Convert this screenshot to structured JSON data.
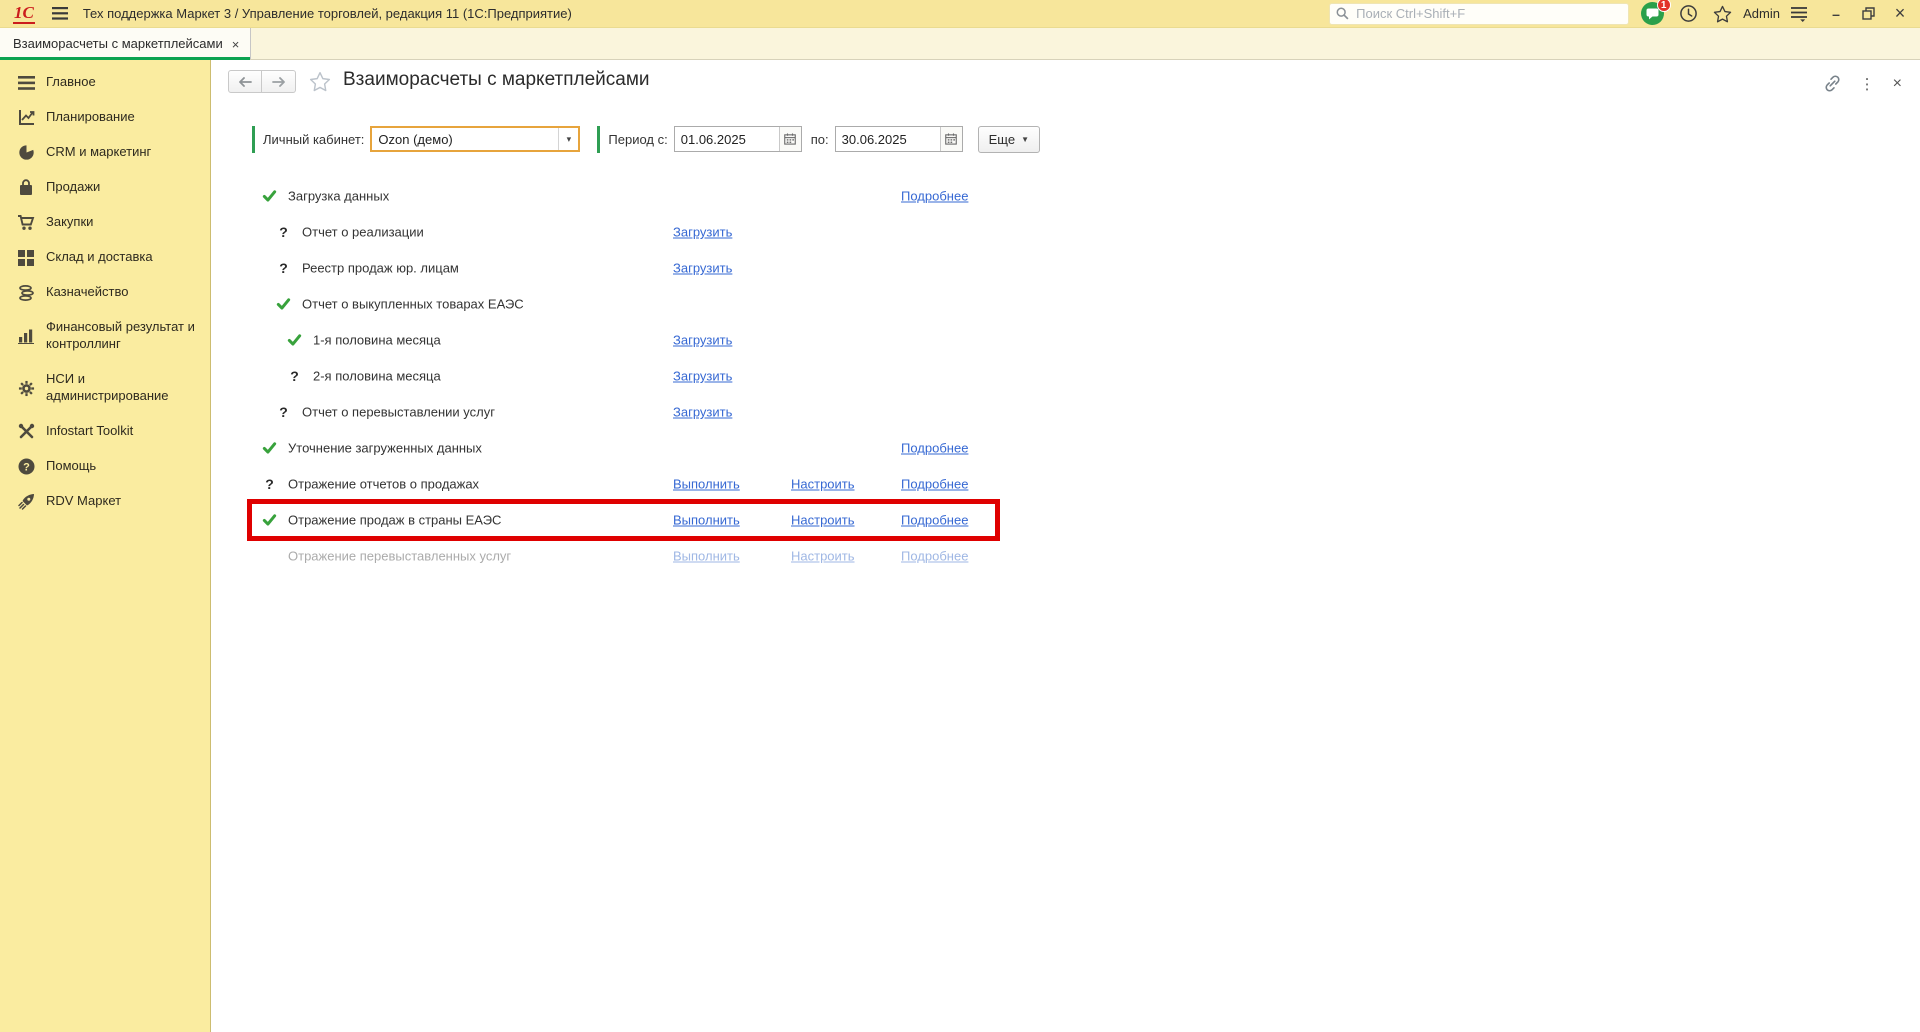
{
  "colors": {
    "topbar_bg": "#F7E69B",
    "sidebar_bg": "#FAECA0",
    "tab_underline_green": "#0BA351",
    "filter_separator_green": "#2F9E53",
    "status_done_green": "#38A23C",
    "link_blue": "#3668D3",
    "link_disabled_blue": "#9FB7E4",
    "text_disabled_gray": "#ABABAB",
    "highlight_red": "#DF0000",
    "focused_field_gold": "#E7A43C",
    "logo_red": "#CB1D1D"
  },
  "icons": {
    "question": "?",
    "dots": "⋮",
    "close": "×",
    "minimize": "–",
    "combo_arrow": "▾",
    "more_arrow": "▼"
  },
  "topbar": {
    "logo": "1С",
    "title": "Тех поддержка Маркет 3 / Управление торговлей, редакция 11  (1С:Предприятие)",
    "search_placeholder": "Поиск Ctrl+Shift+F",
    "notification_badge": "1",
    "user": "Admin"
  },
  "tab": {
    "label": "Взаиморасчеты с маркетплейсами",
    "close": "×"
  },
  "sidebar": {
    "items": [
      {
        "icon": "menu-lines-icon",
        "label": "Главное"
      },
      {
        "icon": "planning-chart-icon",
        "label": "Планирование"
      },
      {
        "icon": "pie-chart-icon",
        "label": "CRM и маркетинг"
      },
      {
        "icon": "shopping-bag-icon",
        "label": "Продажи"
      },
      {
        "icon": "shopping-cart-icon",
        "label": "Закупки"
      },
      {
        "icon": "warehouse-grid-icon",
        "label": "Склад и доставка"
      },
      {
        "icon": "coins-icon",
        "label": "Казначейство"
      },
      {
        "icon": "bar-chart-icon",
        "label": "Финансовый результат и\nконтроллинг"
      },
      {
        "icon": "gear-icon",
        "label": "НСИ и\nадминистрирование"
      },
      {
        "icon": "tools-icon",
        "label": "Infostart Toolkit"
      },
      {
        "icon": "help-icon",
        "label": "Помощь"
      },
      {
        "icon": "rocket-icon",
        "label": "RDV Маркет"
      }
    ]
  },
  "page": {
    "title": "Взаиморасчеты с маркетплейсами",
    "filter": {
      "cabinet_label": "Личный кабинет:",
      "cabinet_value": "Ozon (демо)",
      "period_from_label": "Период с:",
      "period_from_value": "01.06.2025",
      "period_to_label": "по:",
      "period_to_value": "30.06.2025",
      "more_label": "Еще"
    },
    "tasks": [
      {
        "label": "Загрузка данных",
        "status": "done",
        "details": "Подробнее"
      },
      {
        "label": "Отчет о реализации",
        "status": "question",
        "load": "Загрузить"
      },
      {
        "label": "Реестр продаж юр. лицам",
        "status": "question",
        "load": "Загрузить"
      },
      {
        "label": "Отчет о выкупленных товарах ЕАЭС",
        "status": "done"
      },
      {
        "label": "1-я половина месяца",
        "status": "done",
        "load": "Загрузить"
      },
      {
        "label": "2-я половина месяца",
        "status": "question",
        "load": "Загрузить"
      },
      {
        "label": "Отчет о перевыставлении услуг",
        "status": "question",
        "load": "Загрузить"
      },
      {
        "label": "Уточнение загруженных данных",
        "status": "done",
        "details": "Подробнее"
      },
      {
        "label": "Отражение отчетов о продажах",
        "status": "question",
        "run": "Выполнить",
        "configure": "Настроить",
        "details": "Подробнее"
      },
      {
        "label": "Отражение продаж в страны ЕАЭС",
        "status": "done",
        "run": "Выполнить",
        "configure": "Настроить",
        "details": "Подробнее",
        "highlighted": true
      },
      {
        "label": "Отражение перевыставленных услуг",
        "status": "none",
        "run": "Выполнить",
        "configure": "Настроить",
        "details": "Подробнее",
        "disabled": true
      }
    ]
  }
}
